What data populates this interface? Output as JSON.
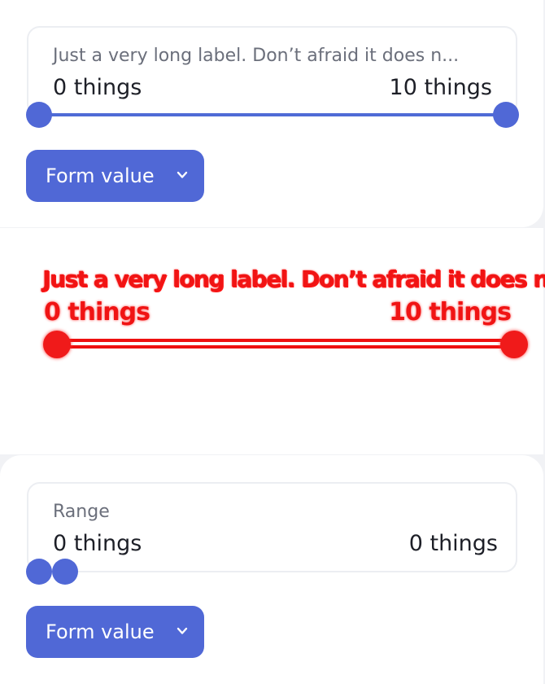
{
  "top_slider": {
    "label": "Just a very long label. Don’t afraid it does n...",
    "min_value": "0 things",
    "max_value": "10 things",
    "range_start": 0,
    "range_end": 10
  },
  "top_button": {
    "label": "Form value"
  },
  "ghost_slider": {
    "label": "Just a very long label. Don’t afraid it does n...",
    "min_value": "0 things",
    "max_value": "10 things",
    "color": "#f01414"
  },
  "bottom_slider": {
    "label": "Range",
    "min_value": "0 things",
    "max_value": "0 things",
    "range_start": 0,
    "range_end": 0
  },
  "bottom_button": {
    "label": "Form value"
  },
  "colors": {
    "accent": "#5068d6",
    "ghost": "#f01414",
    "background": "#f1f2f5"
  }
}
